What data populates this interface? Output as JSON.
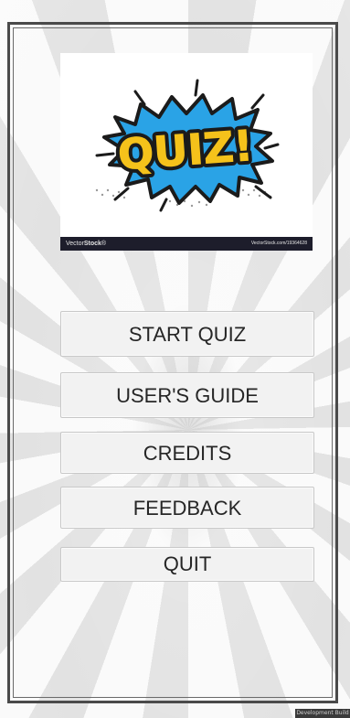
{
  "logo": {
    "word": "QUIZ!",
    "brand_prefix": "Vector",
    "brand_bold": "Stock",
    "brand_mark": "®",
    "stock_id": "VectorStock.com/19364628"
  },
  "menu": {
    "start_label": "START QUIZ",
    "guide_label": "USER'S GUIDE",
    "credits_label": "CREDITS",
    "feedback_label": "FEEDBACK",
    "quit_label": "QUIT"
  },
  "footer": {
    "build_badge": "Development Build"
  },
  "colors": {
    "burst_blue": "#2aa3e6",
    "text_yellow": "#f5c21b",
    "outline": "#1b1b1b",
    "button_bg": "#f2f2f2"
  }
}
